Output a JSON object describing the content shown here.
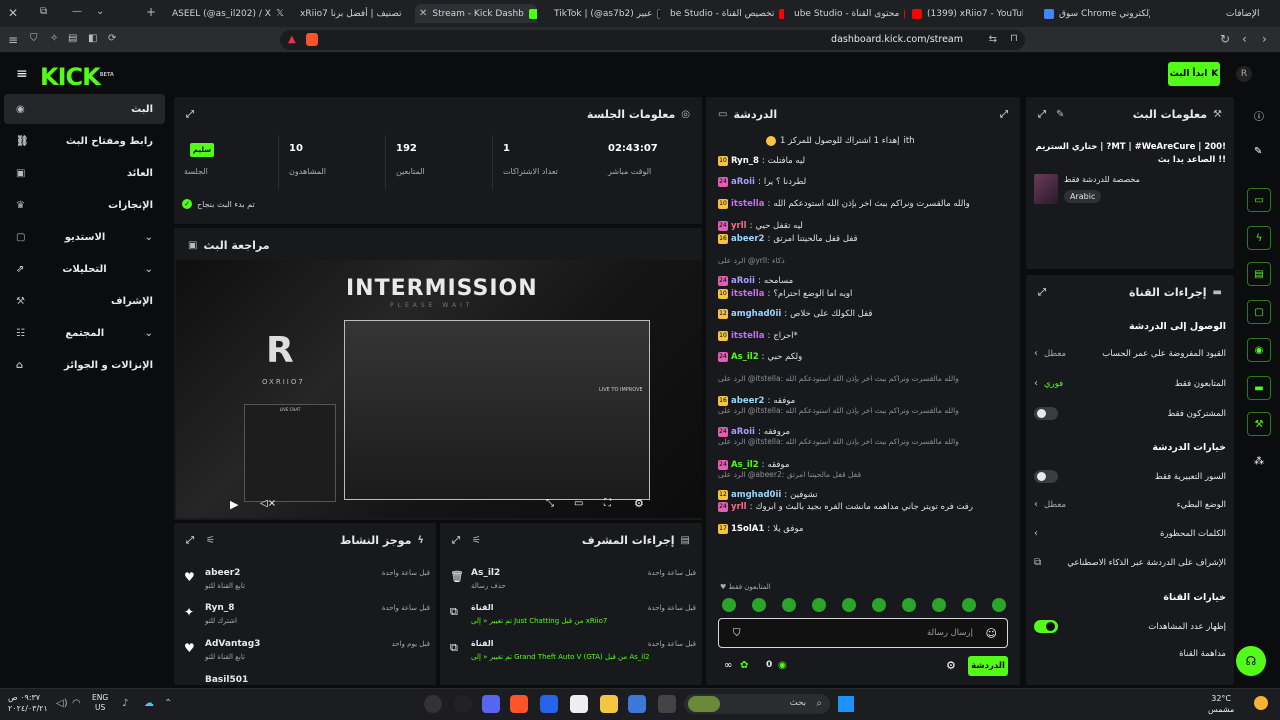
{
  "browser": {
    "tabs": [
      {
        "label": "الإضافات",
        "color": "#9aa0a6"
      },
      {
        "label": "سوق Chrome الإلكتروني",
        "color": "#4285f4"
      },
      {
        "label": "(1399) xRiio7 - YouTube",
        "color": "#ff0000"
      },
      {
        "label": "ube Studio - محتوى القناة",
        "color": "#ff0000"
      },
      {
        "label": "be Studio - تخصيص القناة",
        "color": "#ff0000"
      },
      {
        "label": "TikTok | (@as7b2) عبير",
        "color": "#ffffff"
      },
      {
        "label": "Stream - Kick Dashb",
        "color": "#53fc18"
      },
      {
        "label": "xRiio7 تصنيف | أفضل برنا",
        "color": "#ffffff"
      },
      {
        "label": "ASEEL (@as_il202) / X",
        "color": "#ffffff"
      }
    ],
    "url": "dashboard.kick.com/stream"
  },
  "topbar": {
    "logo": "KICK",
    "beta": "BETA",
    "go_live": "ابدأ البث"
  },
  "sidebar": {
    "items": [
      {
        "label": "البث",
        "icon": "broadcast-icon"
      },
      {
        "label": "رابط ومفتاح البث",
        "icon": "link-icon"
      },
      {
        "label": "العائد",
        "icon": "money-icon"
      },
      {
        "label": "الإنجازات",
        "icon": "trophy-icon"
      },
      {
        "label": "الاستديو",
        "icon": "studio-icon"
      },
      {
        "label": "التحليلات",
        "icon": "analytics-icon"
      },
      {
        "label": "الإشراف",
        "icon": "moderation-icon"
      },
      {
        "label": "المجتمع",
        "icon": "community-icon"
      },
      {
        "label": "الإنزالات و الجوائز",
        "icon": "drops-icon"
      }
    ]
  },
  "session": {
    "title": "معلومات الجلسة",
    "live_badge": "سليم",
    "stats": [
      {
        "value": "02:43:07",
        "label": "الوقت مباشر"
      },
      {
        "value": "1",
        "label": "تعداد الاشتراكات"
      },
      {
        "value": "192",
        "label": "المتابعين"
      },
      {
        "value": "10",
        "label": "المشاهدون"
      }
    ],
    "live_label": "الجلسة",
    "status": "تم بدء البث بنجاح"
  },
  "preview": {
    "title": "مراجعة البث",
    "overlay_title": "INTERMISSION",
    "overlay_sub": "PLEASE WAIT",
    "brand": "OXRIIO7",
    "live_to": "LIVE TO IMPROVE",
    "chat_box": "LIVE CHAT"
  },
  "chat": {
    "title": "الدردشة",
    "pinned": "إهداء 1 اشتراك للوصول للمركز 1",
    "pinned_tag": "ith",
    "messages": [
      {
        "user": "Ryn_8",
        "text": "ليه مافتلت",
        "color": "#ffffff",
        "badge": "10"
      },
      {
        "user": "aRoii",
        "text": "لطردنا ؟ يرا",
        "color": "#a99cff",
        "badge": "24"
      },
      {
        "user": "itstella",
        "text": "والله مالقسرت ونراكم ببث اخر بإذن الله استودعكم الله",
        "color": "#c86bff",
        "badge": "10"
      },
      {
        "user": "yrll",
        "text": "ليه تقفل حيي",
        "color": "#ff6b8b",
        "badge": "24"
      },
      {
        "user": "abeer2",
        "text": "قفل قفل مالحيتنا امرتق",
        "color": "#9ad7ff",
        "badge": "16"
      },
      {
        "reply": "الرد على @yrll: ذكاء"
      },
      {
        "user": "aRoii",
        "text": "مسامحه",
        "color": "#a99cff",
        "badge": "24"
      },
      {
        "user": "itstella",
        "text": "اويه اما الوضع احترام؟",
        "color": "#c86bff",
        "badge": "10"
      },
      {
        "user": "amghad0ii",
        "text": "قفل الكولك على خلاص",
        "color": "#9ad7ff",
        "badge": "12"
      },
      {
        "user": "itstella",
        "text": "احراج*",
        "color": "#c86bff",
        "badge": "10"
      },
      {
        "user": "As_il2",
        "text": "ولكم حبي",
        "color": "#53fc18",
        "badge": "24"
      },
      {
        "reply": "الرد على @itstella: والله مالقسرت ونراكم ببث اخر بإذن الله استودعكم الله"
      },
      {
        "user": "abeer2",
        "text": "موفقه",
        "color": "#9ad7ff",
        "badge": "16"
      },
      {
        "reply": "الرد على @itstella: والله مالقسرت ونراكم ببث اخر بإذن الله استودعكم الله"
      },
      {
        "user": "aRoii",
        "text": "مروفقه",
        "color": "#a99cff",
        "badge": "24"
      },
      {
        "reply": "الرد على @itstella: والله مالقسرت ونراكم ببث اخر بإذن الله استودعكم الله"
      },
      {
        "user": "As_il2",
        "text": "موفقه",
        "color": "#53fc18",
        "badge": "24"
      },
      {
        "reply": "الرد على @abeer2: قفل قفل مالحيتنا امرتق"
      },
      {
        "user": "amghad0ii",
        "text": "تشوفين",
        "color": "#9ad7ff",
        "badge": "12"
      },
      {
        "user": "yrll",
        "text": "رفت فره تويتر جاني مداهمه مانشت الفره بجيد بالبث و ابروك",
        "color": "#ff6b8b",
        "badge": "24"
      },
      {
        "user": "1SolA1",
        "text": "موفق يلا",
        "color": "#ffffff",
        "badge": "17"
      }
    ],
    "followers_only": "المتابعون فقط",
    "input_placeholder": "إرسال رسالة",
    "send": "الدردشة",
    "count": "0"
  },
  "stream_info": {
    "title": "معلومات البث",
    "stream_title": "!MT | #WeAreCure | 200? | حتاري الستريم !! الصاعد يدا بث",
    "category": "مخصصة للدردشة فقط",
    "language": "Arabic"
  },
  "channel_actions": {
    "title": "إجراءات القناة",
    "sections": [
      {
        "title": "الوصول إلى الدردشة"
      },
      {
        "title": "خيارات الدردشة"
      },
      {
        "title": "خيارات القناة"
      }
    ],
    "rows": [
      {
        "label": "القيود المفروضة على عمر الحساب",
        "value": "معطل",
        "type": "chevron"
      },
      {
        "label": "المتابعون فقط",
        "value": "فوري",
        "type": "chevron-green"
      },
      {
        "label": "المشتركون فقط",
        "value": "",
        "type": "toggle-off"
      },
      {
        "label": "السور التعبيرية فقط",
        "value": "",
        "type": "toggle-off"
      },
      {
        "label": "الوضع البطيء",
        "value": "معطل",
        "type": "chevron"
      },
      {
        "label": "الكلمات المحظورة",
        "value": "",
        "type": "chevron"
      },
      {
        "label": "الإشراف على الدردشة عبر الذكاء الاصطناعي",
        "value": "",
        "type": "external"
      },
      {
        "label": "إظهار عدد المشاهدات",
        "value": "",
        "type": "toggle-on"
      },
      {
        "label": "مداهمة القناة",
        "value": "",
        "type": "none"
      }
    ]
  },
  "activity": {
    "title": "موجز النشاط",
    "items": [
      {
        "user": "abeer2",
        "desc": "تابع القناة للتو",
        "time": "قبل ساعة واحدة",
        "icon": "heart-icon"
      },
      {
        "user": "Ryn_8",
        "desc": "اشترك للتو",
        "time": "قبل ساعة واحدة",
        "icon": "star-icon"
      },
      {
        "user": "AdVantag3",
        "desc": "تابع القناة للتو",
        "time": "قبل يوم واحد",
        "icon": "heart-icon"
      },
      {
        "user": "Basil501",
        "desc": "",
        "time": "",
        "icon": "heart-icon"
      }
    ]
  },
  "mod_actions": {
    "title": "إجراءات المشرف",
    "items": [
      {
        "user": "As_il2",
        "desc": "حذف رسالة",
        "time": "قبل ساعة واحدة",
        "icon": "trash-icon"
      },
      {
        "user": "القناة",
        "desc": "تم تغيير « إلى Just Chatting من قبل xRiio7",
        "time": "قبل ساعة واحدة",
        "icon": "copy-icon"
      },
      {
        "user": "القناة",
        "desc": "تم تغيير « إلى Grand Theft Auto V (GTA) من قبل As_il2",
        "time": "قبل ساعة واحدة",
        "icon": "copy-icon"
      }
    ]
  },
  "taskbar": {
    "search": "بحث",
    "time": "٠٩:٣٧ ص",
    "date": "٢٠٢٤/٠٣/٢١",
    "lang": "ENG",
    "region": "US",
    "weather_temp": "32°C",
    "weather_desc": "مشمس"
  }
}
